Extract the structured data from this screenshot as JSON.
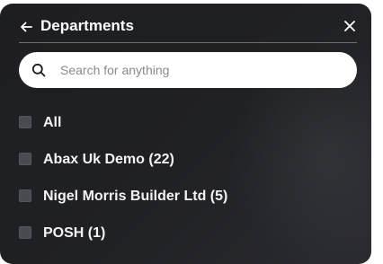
{
  "header": {
    "title": "Departments"
  },
  "search": {
    "placeholder": "Search for anything",
    "value": ""
  },
  "departments": [
    {
      "label": "All",
      "checked": false
    },
    {
      "label": "Abax Uk Demo (22)",
      "checked": false
    },
    {
      "label": "Nigel Morris Builder Ltd (5)",
      "checked": false
    },
    {
      "label": "POSH (1)",
      "checked": false
    }
  ],
  "icons": {
    "back": "arrow-left-icon",
    "close": "close-icon",
    "search": "search-icon"
  },
  "colors": {
    "panel_background": "#202125",
    "text": "#ffffff",
    "checkbox": "#4a4b50",
    "search_background": "#ffffff"
  }
}
